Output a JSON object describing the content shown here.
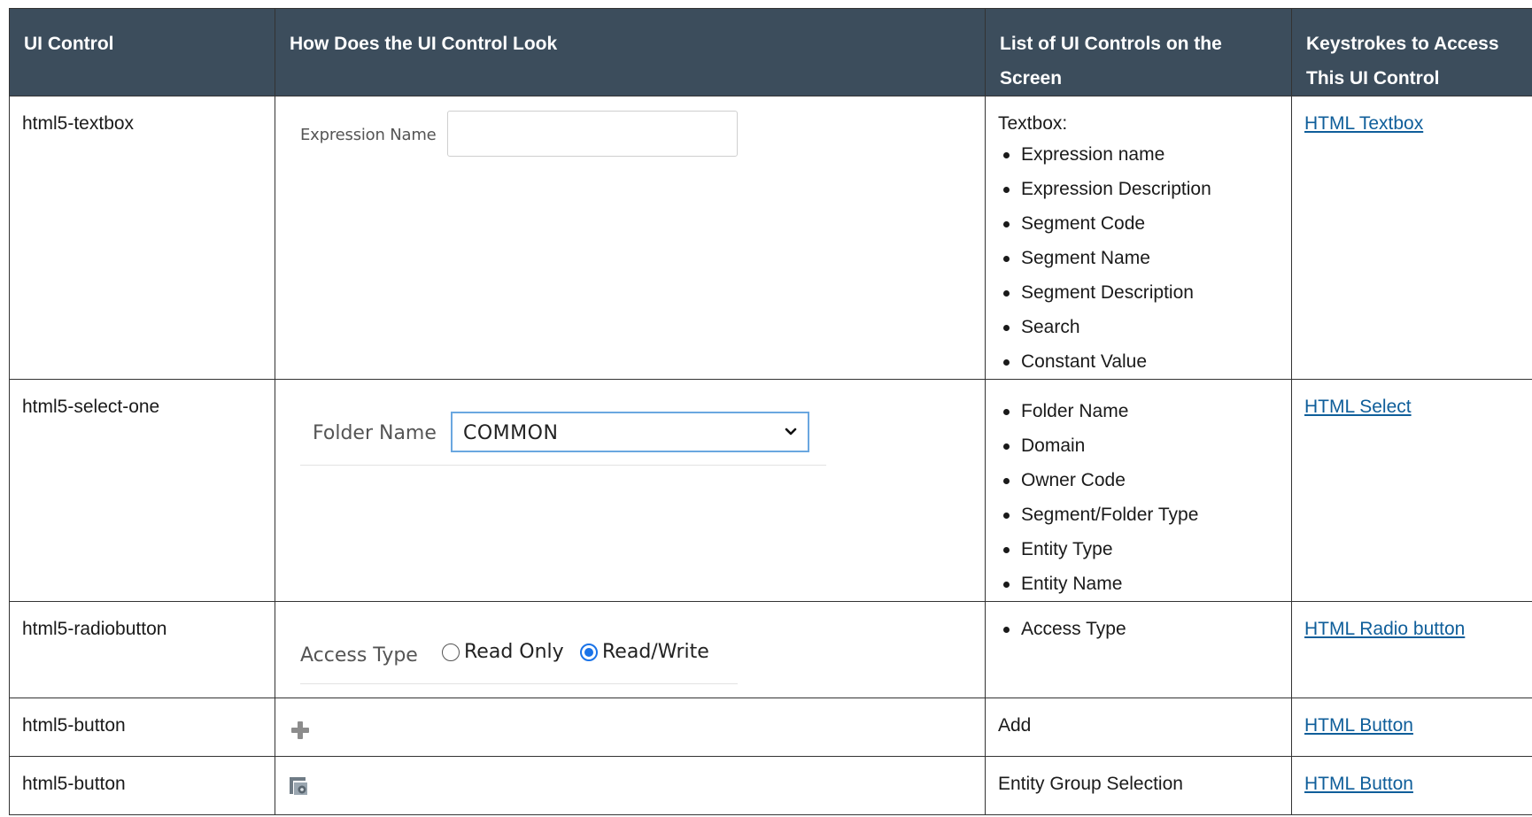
{
  "headers": [
    "UI Control",
    "How Does the UI Control Look",
    "List of UI Controls on the Screen",
    "Keystrokes to Access This UI Control"
  ],
  "rows": [
    {
      "control": "html5-textbox",
      "preview": {
        "label": "Expression Name"
      },
      "list_intro": "Textbox:",
      "items": [
        "Expression name",
        "Expression Description",
        "Segment Code",
        "Segment Name",
        "Segment Description",
        "Search",
        "Constant Value"
      ],
      "link": "HTML Textbox"
    },
    {
      "control": "html5-select-one",
      "preview": {
        "label": "Folder Name",
        "value": "COMMON"
      },
      "items": [
        "Folder Name",
        "Domain",
        "Owner Code",
        "Segment/Folder Type",
        "Entity Type",
        "Entity Name"
      ],
      "link": "HTML Select"
    },
    {
      "control": "html5-radiobutton",
      "preview": {
        "label": "Access Type",
        "options": [
          "Read Only",
          "Read/Write"
        ],
        "selected": "Read/Write"
      },
      "items": [
        "Access Type"
      ],
      "link": "HTML Radio button"
    },
    {
      "control": "html5-button",
      "preview": {
        "icon": "plus-icon"
      },
      "list_text": "Add",
      "link": "HTML Button"
    },
    {
      "control": "html5-button",
      "preview": {
        "icon": "entity-group-icon"
      },
      "list_text": "Entity Group Selection",
      "link": "HTML Button"
    }
  ],
  "colors": {
    "header_bg": "#3c4d5c",
    "link": "#0f5e9a",
    "radio_selected": "#1a73e8",
    "select_border": "#6aa7e0"
  }
}
